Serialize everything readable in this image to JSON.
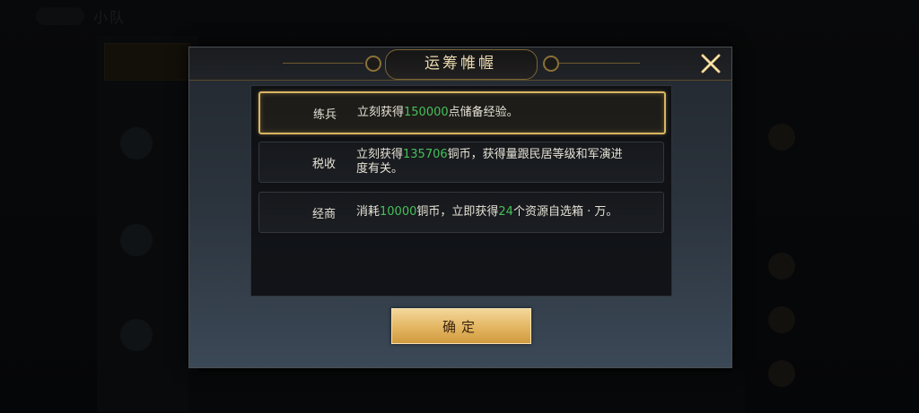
{
  "background": {
    "top_title": "小队"
  },
  "dialog": {
    "title": "运筹帷幄",
    "confirm_label": "确定",
    "options": [
      {
        "name": "练兵",
        "desc_pre": "立刻获得",
        "num1": "150000",
        "desc_mid": "点储备经验。",
        "num2": "",
        "desc_post": ""
      },
      {
        "name": "税收",
        "desc_pre": "立刻获得",
        "num1": "135706",
        "desc_mid": "铜币，获得量跟民居等级和军演进度有关。",
        "num2": "",
        "desc_post": ""
      },
      {
        "name": "经商",
        "desc_pre": "消耗",
        "num1": "10000",
        "desc_mid": "铜币，立即获得",
        "num2": "24",
        "desc_post": "个资源自选箱 · 万。"
      }
    ]
  },
  "colors": {
    "highlight_number": "#46c05a",
    "selected_border": "#d9b562",
    "button_gold": "#e3b560"
  },
  "icons": {
    "close": "close-x-icon"
  }
}
